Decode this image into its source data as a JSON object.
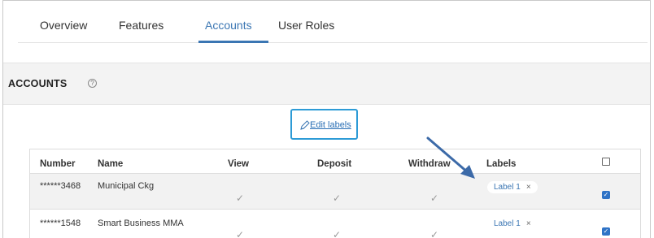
{
  "tabs": [
    {
      "label": "Overview",
      "active": false
    },
    {
      "label": "Features",
      "active": false
    },
    {
      "label": "Accounts",
      "active": true
    },
    {
      "label": "User Roles",
      "active": false
    }
  ],
  "section": {
    "title": "ACCOUNTS",
    "help_icon": "question-circle-icon"
  },
  "edit_labels": {
    "label": "Edit labels",
    "icon": "pencil-icon"
  },
  "table": {
    "headers": [
      "Number",
      "Name",
      "View",
      "Deposit",
      "Withdraw",
      "Labels"
    ],
    "rows": [
      {
        "number": "******3468",
        "name": "Municipal Ckg",
        "view": "✓",
        "deposit": "✓",
        "withdraw": "✓",
        "label": "Label 1",
        "remove": "×",
        "selected": true
      },
      {
        "number": "******1548",
        "name": "Smart Business MMA",
        "view": "✓",
        "deposit": "✓",
        "withdraw": "✓",
        "label": "Label 1",
        "remove": "×",
        "selected": true
      }
    ]
  },
  "colors": {
    "accent": "#3b76b3",
    "highlight_border": "#2d9bd6",
    "arrow": "#3c6aa8",
    "checkbox": "#2f73c6"
  }
}
